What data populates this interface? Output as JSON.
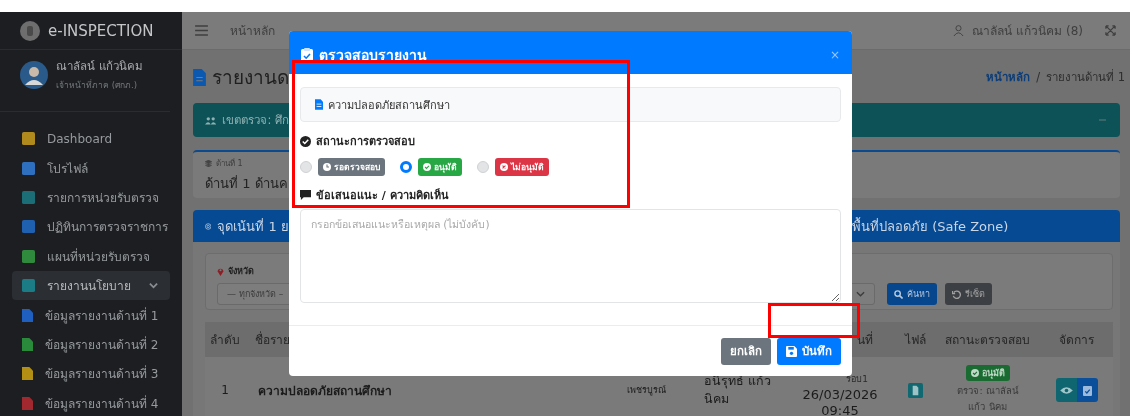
{
  "sidebar": {
    "brand": "e-INSPECTION",
    "user_name": "ณาลัลน์ แก้วนิคม",
    "user_role": "เจ้าหน้าที่ภาค (ศกภ.)",
    "items": [
      {
        "label": "Dashboard",
        "color": "#b08a1c",
        "selected": false
      },
      {
        "label": "โปรไฟล์",
        "color": "#2f6fc0",
        "selected": false
      },
      {
        "label": "รายการหน่วยรับตรวจ",
        "color": "#1b6e76",
        "selected": false
      },
      {
        "label": "ปฏิทินการตรวจราชการ",
        "color": "#2060b0",
        "selected": false
      },
      {
        "label": "แผนที่หน่วยรับตรวจ",
        "color": "#2f8a3e",
        "selected": false
      },
      {
        "label": "รายงานนโยบาย",
        "color": "#1b7c86",
        "selected": true,
        "expanded": true,
        "children": [
          {
            "label": "ข้อมูลรายงานด้านที่ 1",
            "color": "#1f5fbf",
            "selected": false
          },
          {
            "label": "ข้อมูลรายงานด้านที่ 2",
            "color": "#2a8a3c",
            "selected": false
          },
          {
            "label": "ข้อมูลรายงานด้านที่ 3",
            "color": "#b38f14",
            "selected": false
          },
          {
            "label": "ข้อมูลรายงานด้านที่ 4",
            "color": "#a0282e",
            "selected": false
          }
        ]
      }
    ]
  },
  "top_bar": {
    "home_link": "หน้าหลัก",
    "user": "ณาลัลน์ แก้วนิคม (8)"
  },
  "page": {
    "title": "รายงานด",
    "breadcrumb": {
      "link": "หน้าหลัก",
      "separator": "/",
      "current": "รายงานด้านที่ 1"
    },
    "zone_bar": "เขตตรวจ: ศึก",
    "aspect_label": "ด้านที่ 1",
    "aspect_title": "ด้านที่ 1 ด้านค",
    "focus_left": "จุดเน้นที่ 1 ย",
    "focus_right": "พื้นที่ปลอดภัย (Safe Zone)",
    "filter": {
      "label": "จังหวัด",
      "province_value": "— ทุกจังหวัด –",
      "search_button": "ค้นหา",
      "reset_button": "รีเซ็ต"
    },
    "table": {
      "columns": [
        "ลำดับ",
        "ชื่อราย",
        "นที่",
        "ไฟล์",
        "สถานะตรวจสอบ",
        "จัดการ"
      ],
      "rows": [
        {
          "index": "1",
          "name": "ความปลอดภัยสถานศึกษา",
          "province": "เพชรบูรณ์",
          "reporter": "อนิรุทธ์ แก้ว นิคม",
          "round": "รอบ1",
          "date": "26/03/2026",
          "time": "09:45",
          "status": {
            "label": "อนุมัติ",
            "color": "#1a6b32"
          },
          "checked_by": "ตรวจ: ณาลัลน์ แก้ว นิคม"
        }
      ]
    }
  },
  "modal": {
    "title": "ตรวจสอบรายงาน",
    "close": "×",
    "subject": "ความปลอดภัยสถานศึกษา",
    "status_label": "สถานะการตรวจสอบ",
    "options": [
      {
        "label": "รอตรวจสอบ",
        "kind": "pending",
        "color": "#6c757d",
        "selected": false
      },
      {
        "label": "อนุมัติ",
        "kind": "approved",
        "color": "#28a745",
        "selected": true
      },
      {
        "label": "ไม่อนุมัติ",
        "kind": "rejected",
        "color": "#dc3545",
        "selected": false
      }
    ],
    "comment_label": "ข้อเสนอแนะ / ความคิดเห็น",
    "comment_placeholder": "กรอกข้อเสนอแนะหรือเหตุผล (ไม่บังคับ)",
    "cancel_button": "ยกเลิก",
    "save_button": "บันทึก"
  }
}
